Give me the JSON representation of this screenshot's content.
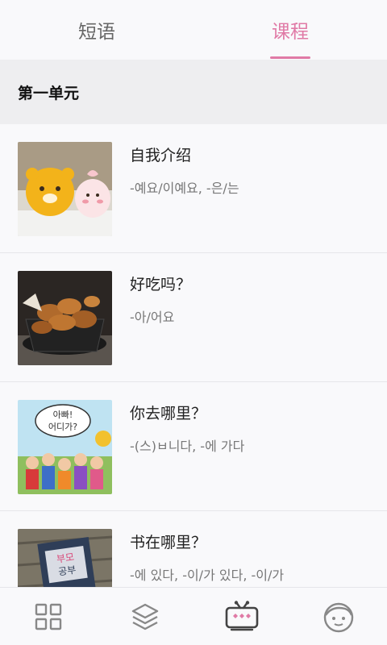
{
  "tabs": [
    {
      "label": "短语",
      "active": false
    },
    {
      "label": "课程",
      "active": true
    }
  ],
  "accent_color": "#e07aa6",
  "section": {
    "title": "第一单元"
  },
  "lessons": [
    {
      "title": "自我介绍",
      "grammar": "-예요/이예요, -은/는",
      "image": "kakao-ryan-apeach-figures"
    },
    {
      "title": "好吃吗？",
      "grammar": "-아/어요",
      "image": "fried-chicken-basket"
    },
    {
      "title": "你去哪里？",
      "grammar": "-(스)ㅂ니다, -에 가다",
      "image": "tv-show-poster",
      "image_text": [
        "아빠!",
        "어디가?"
      ]
    },
    {
      "title": "书在哪里？",
      "grammar": "-에 있다, -이/가 있다, -이/가",
      "image": "book-on-bench",
      "image_text": [
        "부모",
        "공부"
      ]
    }
  ],
  "bottom_nav": [
    {
      "icon": "grid-icon"
    },
    {
      "icon": "layers-icon"
    },
    {
      "icon": "tv-icon",
      "active": true
    },
    {
      "icon": "profile-face-icon"
    }
  ]
}
